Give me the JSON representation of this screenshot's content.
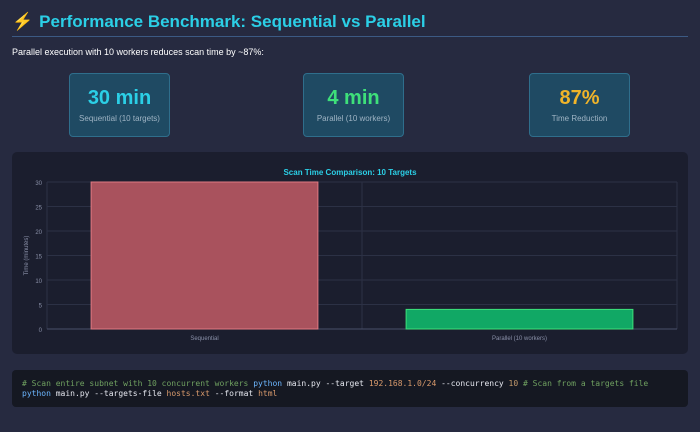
{
  "header": {
    "icon": "lightning-icon",
    "icon_glyph": "⚡",
    "title": "Performance Benchmark: Sequential vs Parallel"
  },
  "intro": "Parallel execution with 10 workers reduces scan time by ~87%:",
  "stats": [
    {
      "value": "30 min",
      "label": "Sequential (10 targets)",
      "color": "#2bcfe6"
    },
    {
      "value": "4 min",
      "label": "Parallel (10 workers)",
      "color": "#3ee07a"
    },
    {
      "value": "87%",
      "label": "Time Reduction",
      "color": "#f0b429"
    }
  ],
  "chart_data": {
    "type": "bar",
    "title": "Scan Time Comparison: 10 Targets",
    "categories": [
      "Sequential",
      "Parallel (10 workers)"
    ],
    "values": [
      30,
      4
    ],
    "colors": [
      "#a9525d",
      "#11a865"
    ],
    "border_colors": [
      "#e07a82",
      "#3ee07a"
    ],
    "ylabel": "Time (minutes)",
    "xlabel": "",
    "ylim": [
      0,
      30
    ],
    "yticks": [
      0,
      5,
      10,
      15,
      20,
      25,
      30
    ],
    "grid": true
  },
  "code": {
    "comment1": "# Scan entire subnet with 10 concurrent workers",
    "cmd1": "python",
    "arg1a": "main.py --target",
    "str1": "192.168.1.0/24",
    "arg1b": "--concurrency",
    "num1": "10",
    "comment2": "# Scan from a targets file",
    "cmd2": "python",
    "arg2a": "main.py --targets-file",
    "str2": "hosts.txt",
    "arg2b": "--format",
    "str3": "html"
  }
}
